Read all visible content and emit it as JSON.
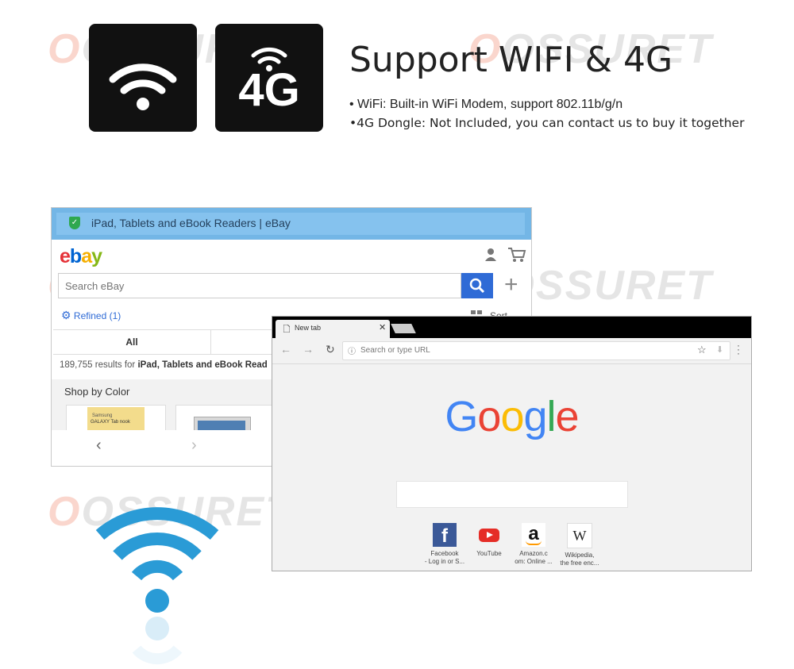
{
  "watermark": {
    "brand": "OSSURET"
  },
  "top_icons": {
    "wifi_icon": "wifi-icon",
    "g4_label": "4G"
  },
  "headline": {
    "title": "Support WIFI & 4G",
    "bullet1": "• WiFi: Built-in WiFi Modem, support 802.11b/g/n",
    "bullet2": "•4G Dongle: Not Included, you can contact us to buy it together"
  },
  "ebay_window": {
    "tab_title": "iPad, Tablets and eBook Readers | eBay",
    "logo": {
      "e": "e",
      "b": "b",
      "a": "a",
      "y": "y"
    },
    "search_placeholder": "Search eBay",
    "refined": "Refined (1)",
    "sort": "Sort",
    "tab_all": "All",
    "results_prefix": "189,755 results for ",
    "results_query": "iPad, Tablets and eBook Read",
    "shop_by_color": "Shop by Color",
    "card1_text1": "Samsung",
    "card1_text2": "GALAXY Tab nook",
    "colors": {
      "blue": "#2f6bd6",
      "bar": "#73b6e6",
      "e": "#e53238",
      "b": "#0064d2",
      "a": "#f5af02",
      "y": "#86b817"
    }
  },
  "chrome_window": {
    "tab_title": "New tab",
    "omnibox_placeholder": "Search or type URL",
    "google_letters": [
      {
        "ch": "G",
        "color": "#4285f4"
      },
      {
        "ch": "o",
        "color": "#ea4335"
      },
      {
        "ch": "o",
        "color": "#fbbc05"
      },
      {
        "ch": "g",
        "color": "#4285f4"
      },
      {
        "ch": "l",
        "color": "#34a853"
      },
      {
        "ch": "e",
        "color": "#ea4335"
      }
    ],
    "tiles": [
      {
        "label1": "Facebook",
        "label2": "- Log in or S...",
        "icon": "facebook-icon"
      },
      {
        "label1": "YouTube",
        "label2": "",
        "icon": "youtube-icon"
      },
      {
        "label1": "Amazon.c",
        "label2": "om: Online ...",
        "icon": "amazon-icon"
      },
      {
        "label1": "Wikipedia,",
        "label2": "the free enc...",
        "icon": "wikipedia-icon"
      }
    ]
  },
  "big_wifi": {
    "icon": "wifi-icon",
    "color": "#2a9bd6"
  }
}
